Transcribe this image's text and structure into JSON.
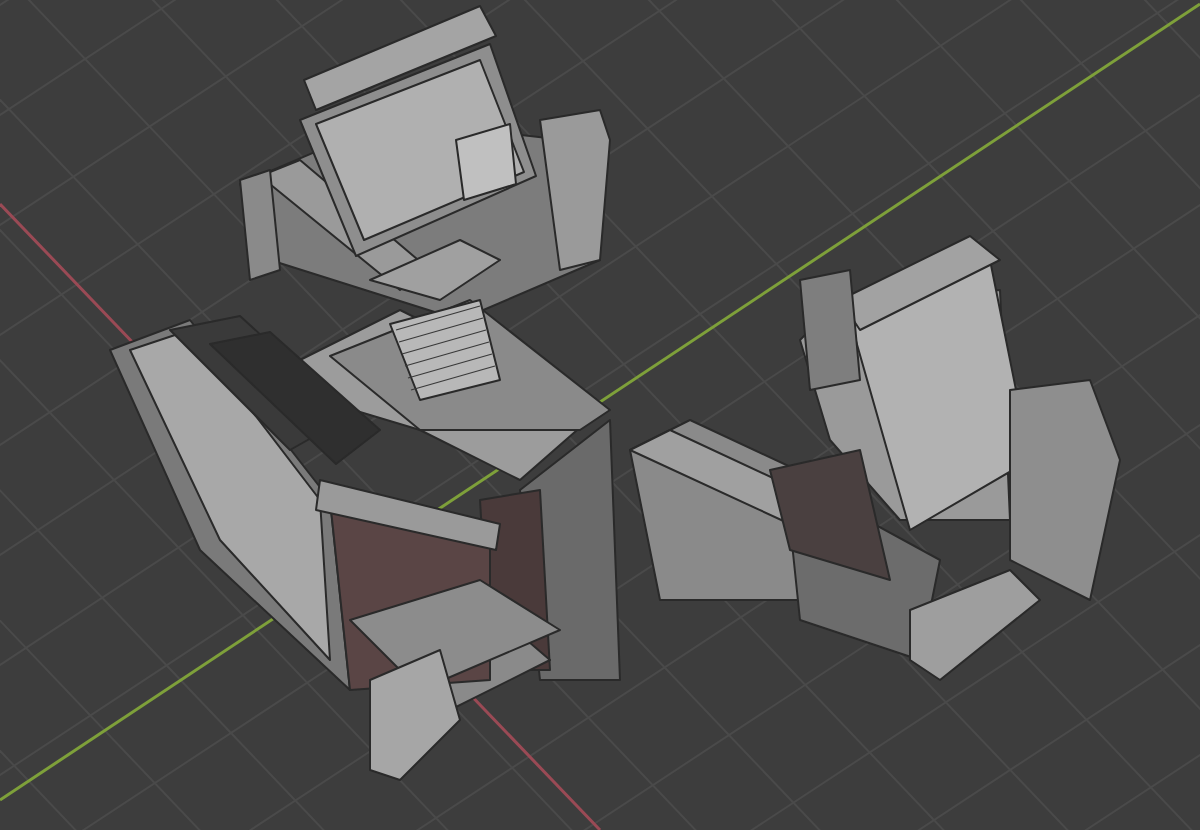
{
  "viewport": {
    "show_floor_grid": true,
    "show_x_axis": true,
    "show_y_axis": true
  }
}
